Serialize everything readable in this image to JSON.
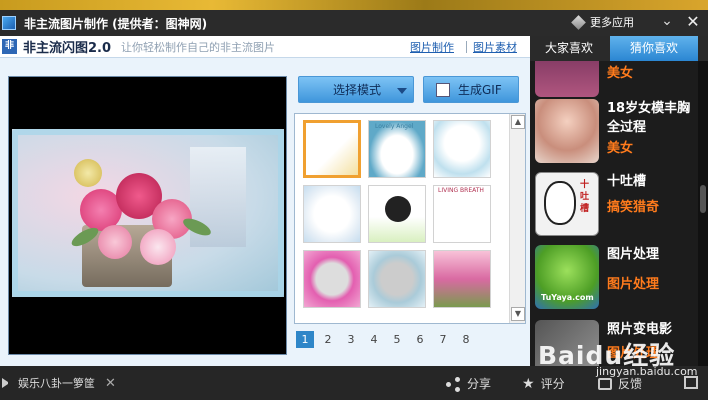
{
  "window": {
    "title": "非主流图片制作 (提供者：图神网)",
    "more_apps": "更多应用",
    "minimize_glyph": "⌄",
    "close_glyph": "✕"
  },
  "header": {
    "logo_text": "非",
    "app_name": "非主流闪图2.0",
    "tagline": "让你轻松制作自己的非主流图片",
    "link_make": "图片制作",
    "link_materials": "图片素材"
  },
  "toolbar": {
    "select_mode_label": "选择模式",
    "generate_gif_label": "生成GIF"
  },
  "gallery": {
    "pages": [
      "1",
      "2",
      "3",
      "4",
      "5",
      "6",
      "7",
      "8"
    ],
    "active_page": "1",
    "thumb_texts": [
      "Lovely Angel",
      "LIVING BREATH"
    ]
  },
  "sidebar": {
    "tabs": [
      "大家喜欢",
      "猜你喜欢"
    ],
    "active_tab": "猜你喜欢",
    "items": [
      {
        "title": "",
        "category": "美女"
      },
      {
        "title": "18岁女模丰胸全过程",
        "category": "美女"
      },
      {
        "title": "十吐槽",
        "category": "搞笑猎奇",
        "thumb_text": "十吐槽"
      },
      {
        "title": "图片处理",
        "category": "图片处理",
        "thumb_text": "TuYaya.com"
      },
      {
        "title": "照片变电影",
        "category": "图片处理"
      }
    ]
  },
  "bottom_bar": {
    "news_text": "娱乐八卦一箩筐",
    "news_close_glyph": "✕",
    "share_label": "分享",
    "rate_label": "评分",
    "feedback_label": "反馈"
  },
  "watermark": {
    "brand": "Baidu经验",
    "url": "jingyan.baidu.com"
  },
  "colors": {
    "accent": "#2f86c8",
    "sidebar_category": "#ff7b1c",
    "title_bar": "#2b2b2b"
  }
}
